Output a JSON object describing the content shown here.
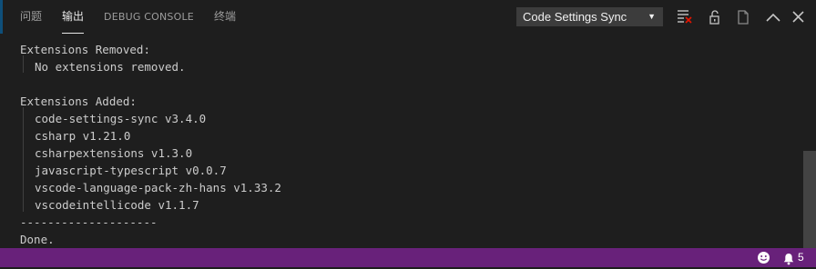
{
  "tabs": [
    {
      "label": "问题",
      "active": false
    },
    {
      "label": "输出",
      "active": true
    },
    {
      "label": "DEBUG CONSOLE",
      "active": false
    },
    {
      "label": "终端",
      "active": false
    }
  ],
  "output_channel": {
    "selected": "Code Settings Sync"
  },
  "toolbar_icons": [
    "clear-output-icon",
    "lock-scroll-icon",
    "open-in-editor-icon",
    "maximize-panel-icon",
    "close-panel-icon"
  ],
  "output_lines": [
    "Extensions Removed:",
    "No extensions removed.",
    "",
    "Extensions Added:",
    "code-settings-sync v3.4.0",
    "csharp v1.21.0",
    "csharpextensions v1.3.0",
    "javascript-typescript v0.0.7",
    "vscode-language-pack-zh-hans v1.33.2",
    "vscodeintellicode v1.1.7",
    "--------------------",
    "Done."
  ],
  "status": {
    "notification_count": "5",
    "color": "#68217a"
  }
}
